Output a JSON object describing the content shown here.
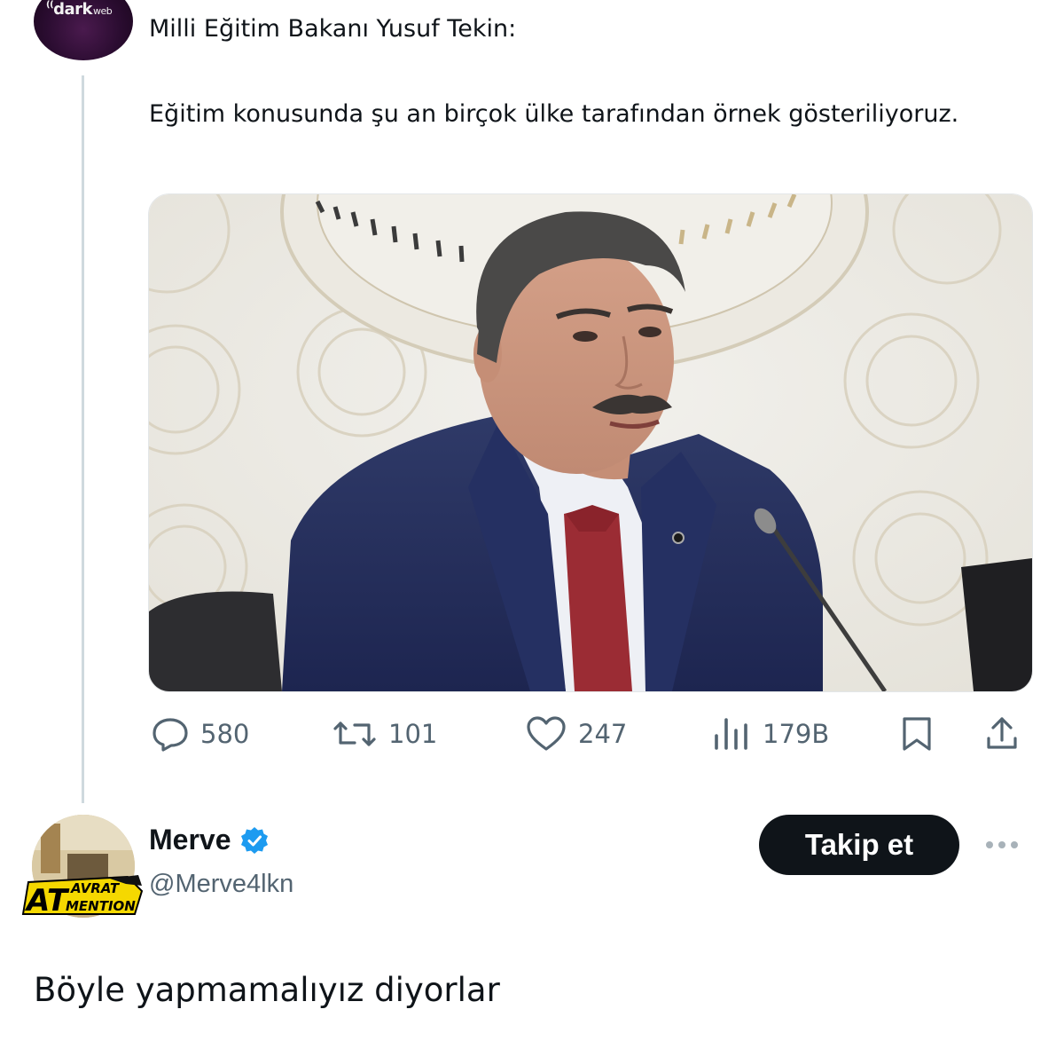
{
  "tweet": {
    "avatar_logo": "darkweb",
    "avatar_logo_main": "dark",
    "avatar_logo_suffix": "web",
    "line1": "Milli Eğitim Bakanı Yusuf Tekin:",
    "line2": "Eğitim konusunda şu an birçok ülke tarafından örnek gösteriliyoruz.",
    "media_icon": "photo-of-speaker-at-microphone",
    "actions": {
      "reply_count": "580",
      "retweet_count": "101",
      "like_count": "247",
      "views_count": "179B"
    },
    "icons": {
      "reply": "reply-icon",
      "retweet": "retweet-icon",
      "like": "heart-icon",
      "views": "views-chart-icon",
      "bookmark": "bookmark-icon",
      "share": "share-icon"
    }
  },
  "reply": {
    "name": "Merve",
    "verified": true,
    "handle": "@Merve4lkn",
    "badge_big": "AT",
    "badge_top": "AVRAT",
    "badge_bottom": "MENTION",
    "follow_label": "Takip et",
    "text": "Böyle yapmamalıyız diyorlar"
  },
  "colors": {
    "text": "#0f1419",
    "muted": "#536471",
    "verified": "#1d9bf0",
    "badge_yellow": "#f5d800",
    "line": "#cfd9de"
  }
}
